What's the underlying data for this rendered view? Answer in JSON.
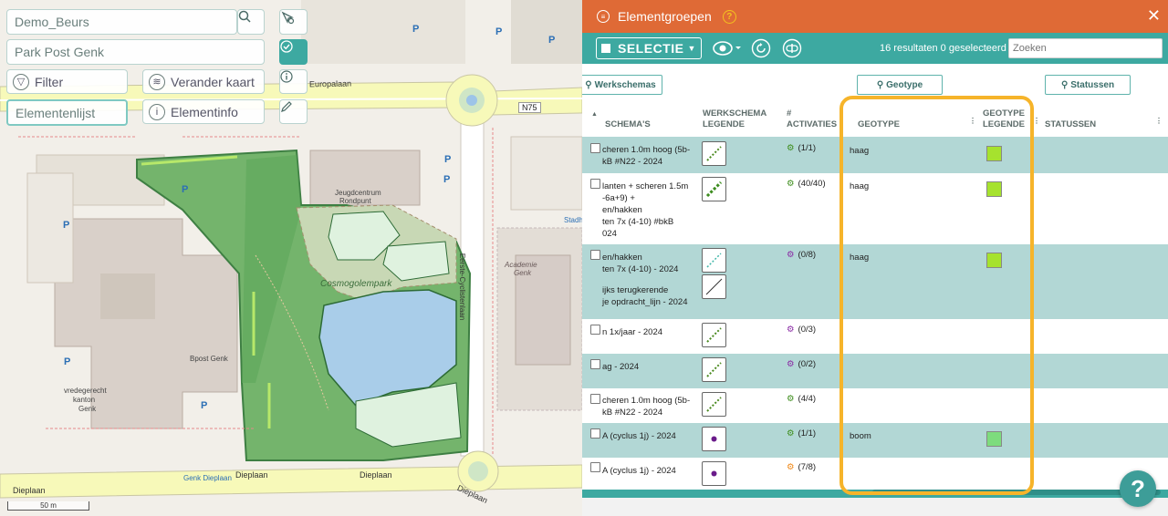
{
  "map": {
    "project_input": "Demo_Beurs",
    "location_input": "Park Post Genk",
    "filter_label": "Filter",
    "change_map_label": "Verander kaart",
    "elementlist_label": "Elementenlijst",
    "elementinfo_label": "Elementinfo",
    "scale_label": "50 m",
    "labels": {
      "europalaan": "Europalaan",
      "n75": "N75",
      "jeugdcentrum": "Jeugdcentrum",
      "rondpunt": "Rondpunt",
      "cosmogolempark": "Cosmogolempark",
      "academie": "Academie",
      "genk_academie": "Genk",
      "eerste_cyclistenlaan": "Eerste-Cyclistenlaan",
      "bpost": "Bpost Genk",
      "vredegerecht": "vredegerecht",
      "kanton": "kanton",
      "genk": "Genk",
      "genk_dieplaan": "Genk Dieplaan",
      "dieplaan1": "Dieplaan",
      "dieplaan2": "Dieplaan",
      "dieplaan3": "Dieplaan",
      "dieplaan4": "Dieplaan",
      "stadh": "Stadh"
    }
  },
  "panel": {
    "title": "Elementgroepen",
    "help_glyph": "?",
    "close_glyph": "✕",
    "toolbar": {
      "selectie_label": "SELECTIE",
      "results_text": "16 resultaten 0 geselecteerd",
      "search_placeholder": "Zoeken"
    },
    "filters": {
      "werkschemas": "Werkschemas",
      "geotype": "Geotype",
      "statussen": "Statussen"
    },
    "columns": {
      "schemas": "SCHEMA'S",
      "werkschema_legende_1": "WERKSCHEMA",
      "werkschema_legende_2": "LEGENDE",
      "activaties_1": "#",
      "activaties_2": "ACTIVATIES",
      "geotype": "GEOTYPE",
      "geotype_legende_1": "GEOTYPE",
      "geotype_legende_2": "LEGENDE",
      "statussen": "STATUSSEN"
    },
    "rows": [
      {
        "name_lines": [
          "cheren 1.0m hoog (5b-",
          "kB #N22 - 2024"
        ],
        "activations": "(1/1)",
        "geotype": "haag",
        "geotype_color": "#a6e22e"
      },
      {
        "name_lines": [
          "lanten + scheren 1.5m",
          "-6a+9) +",
          "en/hakken",
          "ten 7x (4-10) #bkB",
          "024"
        ],
        "activations": "(40/40)",
        "geotype": "haag",
        "geotype_color": "#a6e22e"
      },
      {
        "name_lines": [
          "en/hakken",
          "ten 7x (4-10) - 2024",
          "",
          "ijks terugkerende",
          "je opdracht_lijn - 2024"
        ],
        "activations": "(0/8)",
        "geotype": "haag",
        "geotype_color": "#a6e22e"
      },
      {
        "name_lines": [
          "n 1x/jaar - 2024"
        ],
        "activations": "(0/3)",
        "geotype": "",
        "geotype_color": ""
      },
      {
        "name_lines": [
          "ag - 2024"
        ],
        "activations": "(0/2)",
        "geotype": "",
        "geotype_color": ""
      },
      {
        "name_lines": [
          "cheren 1.0m hoog (5b-",
          "kB #N22 - 2024"
        ],
        "activations": "(4/4)",
        "geotype": "",
        "geotype_color": ""
      },
      {
        "name_lines": [
          "A (cyclus 1j) - 2024"
        ],
        "activations": "(1/1)",
        "geotype": "boom",
        "geotype_color": "#7ddc7d"
      },
      {
        "name_lines": [
          "A (cyclus 1j) - 2024"
        ],
        "activations": "(7/8)",
        "geotype": "",
        "geotype_color": ""
      }
    ]
  },
  "fab_glyph": "?"
}
